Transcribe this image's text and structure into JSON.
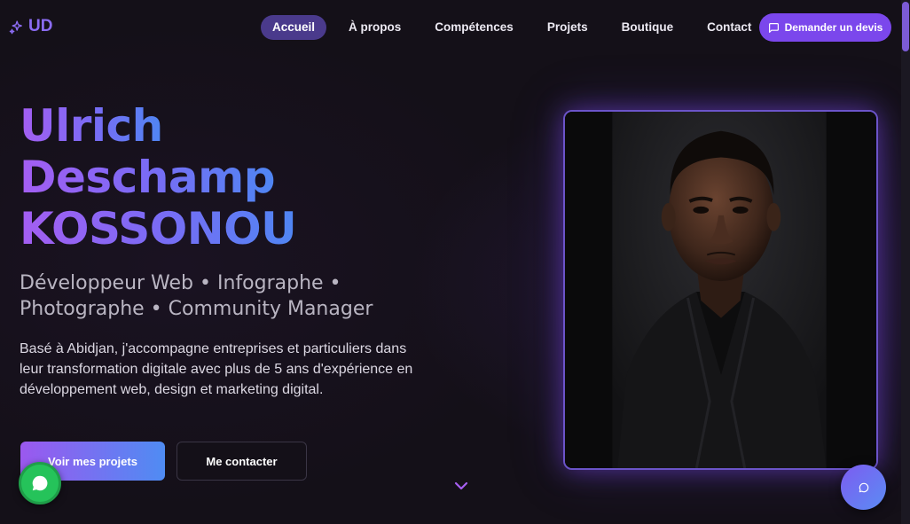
{
  "header": {
    "logo_text": "UD",
    "logo_icon": "sparkles-icon",
    "nav": [
      {
        "label": "Accueil",
        "active": true
      },
      {
        "label": "À propos",
        "active": false
      },
      {
        "label": "Compétences",
        "active": false
      },
      {
        "label": "Projets",
        "active": false
      },
      {
        "label": "Boutique",
        "active": false
      },
      {
        "label": "Contact",
        "active": false
      }
    ],
    "quote_button": {
      "label": "Demander un devis",
      "icon": "message-square-icon"
    }
  },
  "hero": {
    "name_lines": [
      "Ulrich",
      "Deschamp",
      "KOSSONOU"
    ],
    "roles_line1": "Développeur Web • Infographe •",
    "roles_line2": "Photographe • Community Manager",
    "bio": "Basé à Abidjan, j'accompagne entreprises et particuliers dans leur transformation digitale avec plus de 5 ans d'expérience en développement web, design et marketing digital.",
    "primary_button": "Voir mes projets",
    "secondary_button": "Me contacter",
    "scroll_icon": "chevron-down-icon"
  },
  "portrait": {
    "icon": "profile-photo"
  },
  "floating": {
    "whatsapp_icon": "whatsapp-icon",
    "chat_icon": "chat-bubble-icon"
  },
  "colors": {
    "background": "#141018",
    "accent_purple": "#7b47ec",
    "gradient_start": "#a45ef2",
    "gradient_end": "#4f86f3",
    "nav_active": "#4a3a8c",
    "whatsapp_green": "#25c35a"
  }
}
